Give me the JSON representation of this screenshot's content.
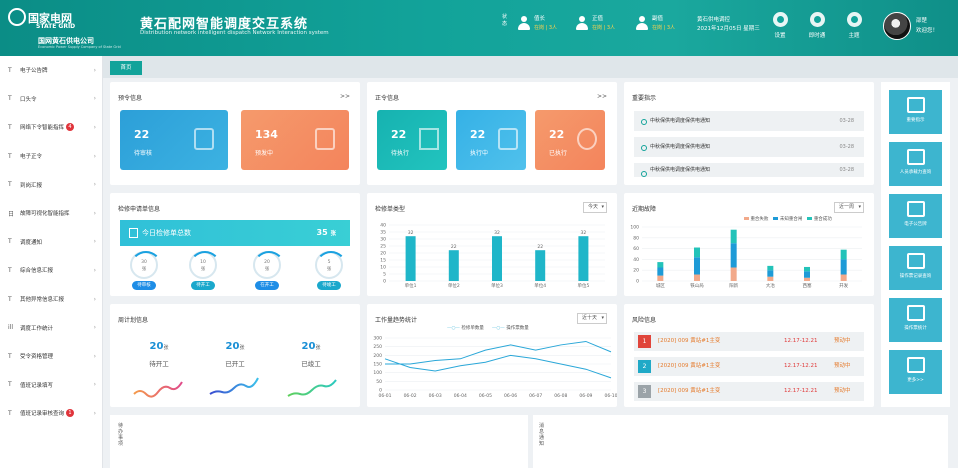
{
  "header": {
    "logo_cn": "国家电网",
    "logo_en": "STATE GRID",
    "company": "国网黄石供电公司",
    "company_en": "Economic Power Supply Company of State Grid",
    "title": "黄石配网智能调度交互系统",
    "subtitle": "Distribution network intelligent dispatch Network Interaction system",
    "status_label": "状态",
    "stats": [
      {
        "name": "值长",
        "value": "在岗 | 3人"
      },
      {
        "name": "正值",
        "value": "在岗 | 3人"
      },
      {
        "name": "副值",
        "value": "在岗 | 3人"
      }
    ],
    "clock_line1": "黄石供电调控",
    "clock_line2": "2021年12月05日 星期三",
    "icons": [
      {
        "label": "设置"
      },
      {
        "label": "即时通"
      },
      {
        "label": "主题"
      }
    ],
    "user_name": "邵楚",
    "user_greeting": "欢迎您！"
  },
  "sidebar": {
    "items": [
      {
        "label": "电子公告牌",
        "icon": "T",
        "badge": ""
      },
      {
        "label": "口头令",
        "icon": "T",
        "badge": ""
      },
      {
        "label": "网络下令智能指挥",
        "icon": "T",
        "badge": "4"
      },
      {
        "label": "电子正令",
        "icon": "T",
        "badge": ""
      },
      {
        "label": "到岗汇报",
        "icon": "T",
        "badge": ""
      },
      {
        "label": "故障可视化智能指挥",
        "icon": "日",
        "badge": ""
      },
      {
        "label": "调度通知",
        "icon": "T",
        "badge": ""
      },
      {
        "label": "综合信息汇报",
        "icon": "T",
        "badge": ""
      },
      {
        "label": "其他异常信息汇报",
        "icon": "T",
        "badge": ""
      },
      {
        "label": "调度工作统计",
        "icon": "ill",
        "badge": ""
      },
      {
        "label": "受令资格管理",
        "icon": "T",
        "badge": ""
      },
      {
        "label": "值班记录填写",
        "icon": "T",
        "badge": ""
      },
      {
        "label": "值班记录审核查询",
        "icon": "T",
        "badge": "1"
      }
    ]
  },
  "tabs": {
    "home": "首页"
  },
  "yuling": {
    "title": "预令信息",
    "more": ">>",
    "tiles": [
      {
        "num": "22",
        "label": "待审核"
      },
      {
        "num": "134",
        "label": "预发中"
      }
    ]
  },
  "zhengling": {
    "title": "正令信息",
    "more": ">>",
    "tiles": [
      {
        "num": "22",
        "label": "待执行"
      },
      {
        "num": "22",
        "label": "执行中"
      },
      {
        "num": "22",
        "label": "已执行"
      }
    ]
  },
  "important": {
    "title": "重要指示",
    "items": [
      {
        "text": "中秋保供电调度保供电通知",
        "date": "03-28"
      },
      {
        "text": "中秋保供电调度保供电通知",
        "date": "03-28"
      },
      {
        "text": "中秋保供电调度保供电通知",
        "date": "03-28"
      }
    ]
  },
  "repair": {
    "title": "检修申请单信息",
    "today_label": "今日检修单总数",
    "today_count": "35",
    "unit": "张",
    "rings": [
      {
        "value": "30",
        "unit": "张",
        "label": "待审核"
      },
      {
        "value": "10",
        "unit": "张",
        "label": "待开工"
      },
      {
        "value": "20",
        "unit": "张",
        "label": "在开工"
      },
      {
        "value": "5",
        "unit": "张",
        "label": "待竣工"
      }
    ]
  },
  "repair_type_chart": {
    "title": "检修单类型",
    "select": "今天"
  },
  "fault_chart": {
    "title": "近期故障",
    "select": "近一周",
    "legend": [
      "重合失败",
      "未知重合闸",
      "重合成功"
    ]
  },
  "week": {
    "title": "周计划信息",
    "items": [
      {
        "num": "20",
        "unit": "张",
        "label": "待开工"
      },
      {
        "num": "20",
        "unit": "张",
        "label": "已开工"
      },
      {
        "num": "20",
        "unit": "张",
        "label": "已竣工"
      }
    ]
  },
  "trend_chart": {
    "title": "工作量趋势统计",
    "select": "近十天",
    "legend": [
      "检修单数量",
      "操作票数量"
    ]
  },
  "risk": {
    "title": "风险信息",
    "items": [
      {
        "no": "1",
        "name": "[2020] 009  黄站#1主变",
        "date": "12.17-12.21",
        "status": "预动中",
        "color": "#e0453b"
      },
      {
        "no": "2",
        "name": "[2020] 009  黄站#1主变",
        "date": "12.17-12.21",
        "status": "预动中",
        "color": "#20a9c7"
      },
      {
        "no": "3",
        "name": "[2020] 009  黄站#1主变",
        "date": "12.17-12.21",
        "status": "预动中",
        "color": "#9ba3a8"
      }
    ]
  },
  "right_panel": {
    "items": [
      {
        "label": "重要指示"
      },
      {
        "label": "人员承载力查询"
      },
      {
        "label": "电子公告牌"
      },
      {
        "label": "操作票记录查询"
      },
      {
        "label": "操作票统计"
      },
      {
        "label": "更多>>"
      }
    ]
  },
  "bottom": {
    "left_label": "待办事项",
    "right_label": "消息通知"
  },
  "chart_data": [
    {
      "type": "bar",
      "title": "检修单类型",
      "categories": [
        "单位1",
        "单位2",
        "单位3",
        "单位4",
        "单位5"
      ],
      "values": [
        32,
        22,
        32,
        22,
        32
      ],
      "ylim": [
        0,
        40
      ],
      "yticks": [
        0,
        5,
        10,
        15,
        20,
        25,
        30,
        35,
        40
      ]
    },
    {
      "type": "bar",
      "title": "近期故障",
      "categories": [
        "城区",
        "铁山局",
        "阳新",
        "大冶",
        "西塞",
        "开发"
      ],
      "series": [
        {
          "name": "重合失败",
          "values": [
            10,
            12,
            25,
            8,
            6,
            12
          ],
          "color": "#f2a98a"
        },
        {
          "name": "未知重合闸",
          "values": [
            15,
            32,
            45,
            12,
            12,
            28
          ],
          "color": "#1e9bd7"
        },
        {
          "name": "重合成功",
          "values": [
            10,
            18,
            25,
            8,
            8,
            18
          ],
          "color": "#23c3b9"
        }
      ],
      "ylim": [
        0,
        100
      ],
      "yticks": [
        0,
        20,
        40,
        60,
        80,
        100
      ]
    },
    {
      "type": "line",
      "title": "工作量趋势统计",
      "categories": [
        "06-01",
        "06-02",
        "06-03",
        "06-04",
        "06-05",
        "06-06",
        "06-07",
        "06-08",
        "06-09",
        "06-10"
      ],
      "series": [
        {
          "name": "检修单数量",
          "values": [
            180,
            130,
            110,
            140,
            160,
            200,
            180,
            150,
            120,
            70
          ]
        },
        {
          "name": "操作票数量",
          "values": [
            150,
            150,
            170,
            180,
            230,
            260,
            230,
            260,
            280,
            220
          ]
        }
      ],
      "ylim": [
        0,
        300
      ],
      "yticks": [
        0,
        50,
        100,
        150,
        200,
        250,
        300
      ]
    }
  ]
}
